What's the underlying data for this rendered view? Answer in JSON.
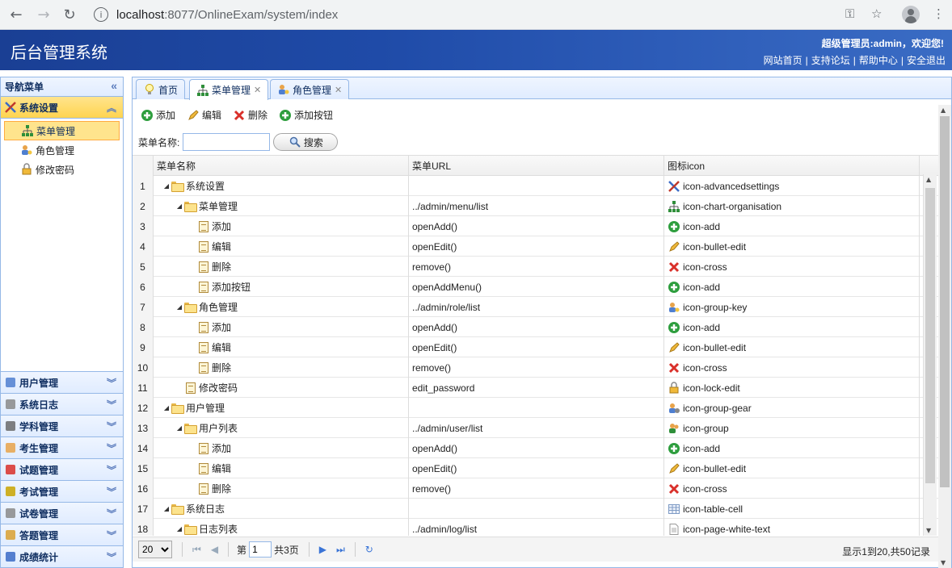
{
  "browser": {
    "url_host": "localhost",
    "url_rest": ":8077/OnlineExam/system/index"
  },
  "header": {
    "title": "后台管理系统",
    "welcome": "超级管理员:admin，欢迎您!",
    "links": [
      "网站首页",
      "支持论坛",
      "帮助中心",
      "安全退出"
    ]
  },
  "sidebar": {
    "title": "导航菜单",
    "active_group": "系统设置",
    "active_items": [
      "菜单管理",
      "角色管理",
      "修改密码"
    ],
    "groups": [
      "用户管理",
      "系统日志",
      "学科管理",
      "考生管理",
      "试题管理",
      "考试管理",
      "试卷管理",
      "答题管理",
      "成绩统计"
    ]
  },
  "tabs": [
    "首页",
    "菜单管理",
    "角色管理"
  ],
  "toolbar": {
    "add": "添加",
    "edit": "编辑",
    "delete": "删除",
    "add_button": "添加按钮"
  },
  "filter": {
    "label": "菜单名称:",
    "value": "",
    "search": "搜索"
  },
  "grid": {
    "columns": [
      "菜单名称",
      "菜单URL",
      "图标icon"
    ],
    "rows": [
      {
        "n": "1",
        "name": "系统设置",
        "url": "",
        "icon": "icon-advancedsettings"
      },
      {
        "n": "2",
        "name": "菜单管理",
        "url": "../admin/menu/list",
        "icon": "icon-chart-organisation"
      },
      {
        "n": "3",
        "name": "添加",
        "url": "openAdd()",
        "icon": "icon-add"
      },
      {
        "n": "4",
        "name": "编辑",
        "url": "openEdit()",
        "icon": "icon-bullet-edit"
      },
      {
        "n": "5",
        "name": "删除",
        "url": "remove()",
        "icon": "icon-cross"
      },
      {
        "n": "6",
        "name": "添加按钮",
        "url": "openAddMenu()",
        "icon": "icon-add"
      },
      {
        "n": "7",
        "name": "角色管理",
        "url": "../admin/role/list",
        "icon": "icon-group-key"
      },
      {
        "n": "8",
        "name": "添加",
        "url": "openAdd()",
        "icon": "icon-add"
      },
      {
        "n": "9",
        "name": "编辑",
        "url": "openEdit()",
        "icon": "icon-bullet-edit"
      },
      {
        "n": "10",
        "name": "删除",
        "url": "remove()",
        "icon": "icon-cross"
      },
      {
        "n": "11",
        "name": "修改密码",
        "url": "edit_password",
        "icon": "icon-lock-edit"
      },
      {
        "n": "12",
        "name": "用户管理",
        "url": "",
        "icon": "icon-group-gear"
      },
      {
        "n": "13",
        "name": "用户列表",
        "url": "../admin/user/list",
        "icon": "icon-group"
      },
      {
        "n": "14",
        "name": "添加",
        "url": "openAdd()",
        "icon": "icon-add"
      },
      {
        "n": "15",
        "name": "编辑",
        "url": "openEdit()",
        "icon": "icon-bullet-edit"
      },
      {
        "n": "16",
        "name": "删除",
        "url": "remove()",
        "icon": "icon-cross"
      },
      {
        "n": "17",
        "name": "系统日志",
        "url": "",
        "icon": "icon-table-cell"
      },
      {
        "n": "18",
        "name": "日志列表",
        "url": "../admin/log/list",
        "icon": "icon-page-white-text"
      }
    ]
  },
  "pager": {
    "page_size": "20",
    "page_prefix": "第",
    "page": "1",
    "page_total": "共3页",
    "info": "显示1到20,共50记录"
  }
}
